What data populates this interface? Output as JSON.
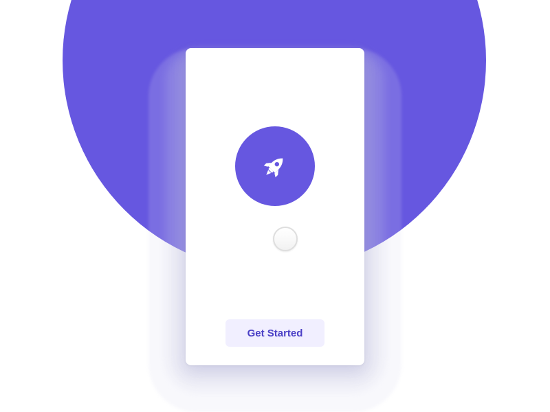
{
  "theme": {
    "accent": "#6657E0",
    "button_bg": "#F1EFFF",
    "button_text": "#4B40C6"
  },
  "hero": {
    "icon": "rocket-icon"
  },
  "cta": {
    "label": "Get Started"
  }
}
